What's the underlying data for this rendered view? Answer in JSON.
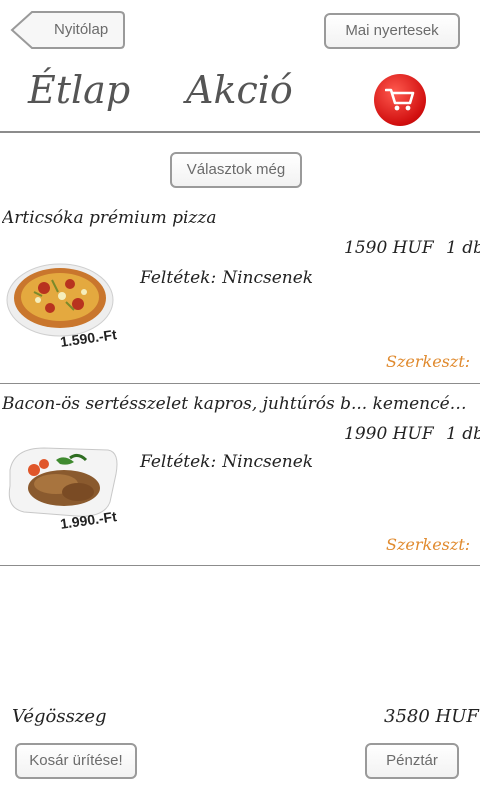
{
  "header": {
    "back_label": "Nyitólap",
    "winners_label": "Mai nyertesek",
    "nav_menu": "Étlap",
    "nav_sale": "Akció",
    "cart_icon": "cart-icon"
  },
  "order": {
    "choose_more_label": "Választok még",
    "extras_label": "Feltétek:",
    "edit_label": "Szerkeszt:",
    "items": [
      {
        "title": "Articsóka prémium pizza",
        "price": "1590 HUF",
        "quantity": "1 db",
        "extras": "Nincsenek",
        "plate_price": "1.590.-Ft"
      },
      {
        "title": "Bacon-ös sertésszelet kapros, juhtúrós b... kemencében s...",
        "price": "1990 HUF",
        "quantity": "1 db",
        "extras": "Nincsenek",
        "plate_price": "1.990.-Ft"
      }
    ]
  },
  "footer": {
    "total_label": "Végösszeg",
    "total_value": "3580 HUF",
    "clear_cart_label": "Kosár ürítése!",
    "checkout_label": "Pénztár"
  },
  "colors": {
    "accent_edit": "#e08a2e",
    "cart_red": "#d10f0f",
    "button_border": "#9a9a9a"
  }
}
